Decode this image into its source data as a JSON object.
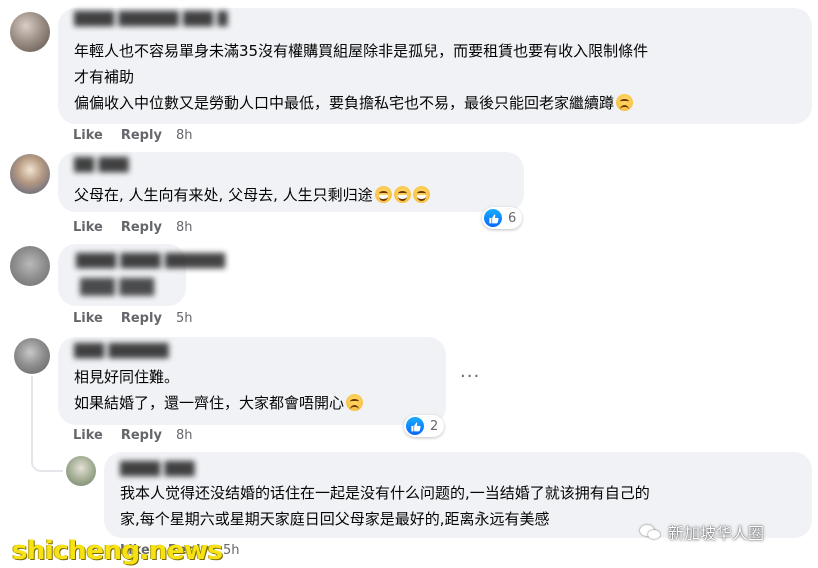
{
  "comments": [
    {
      "author": "████ ██████ ███ █",
      "lines": [
        "年輕人也不容易單身未滿35沒有權購買組屋除非是孤兒，而要租賃也要有收入限制條件",
        "才有補助",
        "偏偏收入中位數又是勞動人口中最低，要負擔私宅也不易，最後只能回老家繼續蹲"
      ],
      "like_label": "Like",
      "reply_label": "Reply",
      "time": "8h"
    },
    {
      "author": "██ ███",
      "lines": [
        "父母在, 人生向有来处, 父母去, 人生只剩归途"
      ],
      "like_label": "Like",
      "reply_label": "Reply",
      "time": "8h",
      "reaction_count": "6"
    },
    {
      "author": "████ ████ ██████",
      "lines": [
        "███ ███"
      ],
      "like_label": "Like",
      "reply_label": "Reply",
      "time": "5h"
    },
    {
      "author": "███ ██████",
      "lines": [
        "相見好同住難。",
        "如果結婚了，還一齊住，大家都會唔開心"
      ],
      "like_label": "Like",
      "reply_label": "Reply",
      "time": "8h",
      "reaction_count": "2",
      "more_label": "···"
    },
    {
      "author": "████ ███",
      "lines": [
        "我本人觉得还没结婚的话住在一起是没有什么问题的,一当结婚了就该拥有自己的",
        "家,每个星期六或星期天家庭日回父母家是最好的,距离永远有美感"
      ],
      "like_label": "Like",
      "reply_label": "Reply",
      "time": "5h"
    }
  ],
  "watermark": {
    "left": "shicheng.news",
    "right": "新加坡华人圈"
  },
  "colors": {
    "bubble": "#f0f2f5",
    "meta_text": "#65676b",
    "like_blue": "#0866ff",
    "watermark_yellow": "#f7e214"
  }
}
